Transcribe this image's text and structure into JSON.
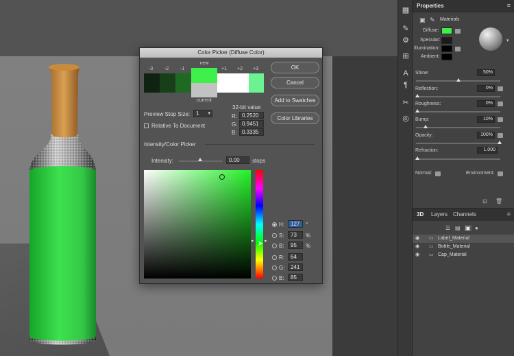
{
  "dialog": {
    "title": "Color Picker (Diffuse Color)",
    "stops": [
      "-3",
      "-2",
      "-1",
      "+1",
      "+2",
      "+3"
    ],
    "stop_colors": [
      "#0f2410",
      "#17401a",
      "#1f6a23",
      "#ffffff",
      "#ffffff",
      "#6cf391"
    ],
    "new_label": "new",
    "current_label": "current",
    "new_color": "#40f04a",
    "current_color": "#c2c2c2",
    "ok_label": "OK",
    "cancel_label": "Cancel",
    "add_swatches_label": "Add to Swatches",
    "color_libraries_label": "Color Libraries",
    "preview_stop_label": "Preview Stop Size:",
    "preview_stop_value": "1",
    "relative_label": "Relative To Document",
    "bit_label": "32-bit value",
    "r32_label": "R:",
    "r32": "0.2520",
    "g32_label": "G:",
    "g32": "0.9451",
    "b32_label": "B:",
    "b32": "0.3335",
    "section_label": "Intensity/Color Picker",
    "intensity_label": "Intensity:",
    "intensity_value": "0.00",
    "stops_unit": "stops",
    "h_label": "H:",
    "h_value": "127",
    "h_unit": "°",
    "s_label": "S:",
    "s_value": "73",
    "s_unit": "%",
    "b_label": "B:",
    "b_value": "95",
    "b_unit": "%",
    "r_label": "R:",
    "r_value": "64",
    "g_label": "G:",
    "g_value": "241",
    "bb_label": "B:",
    "bb_value": "85"
  },
  "properties": {
    "tab": "Properties",
    "materials_label": "Materials",
    "diffuse_label": "Diffuse:",
    "specular_label": "Specular:",
    "illumination_label": "Illumination:",
    "ambient_label": "Ambient:",
    "diffuse_color": "#40f04a",
    "shine_label": "Shine:",
    "shine_value": "50%",
    "reflection_label": "Reflection:",
    "reflection_value": "0%",
    "roughness_label": "Roughness:",
    "roughness_value": "0%",
    "bump_label": "Bump:",
    "bump_value": "10%",
    "opacity_label": "Opacity:",
    "opacity_value": "100%",
    "refraction_label": "Refraction:",
    "refraction_value": "1.000",
    "normal_label": "Normal:",
    "environment_label": "Environment:"
  },
  "layers_panel": {
    "tabs": [
      "3D",
      "Layers",
      "Channels"
    ],
    "rows": [
      "Label_Material",
      "Bottle_Material",
      "Cap_Material"
    ]
  }
}
